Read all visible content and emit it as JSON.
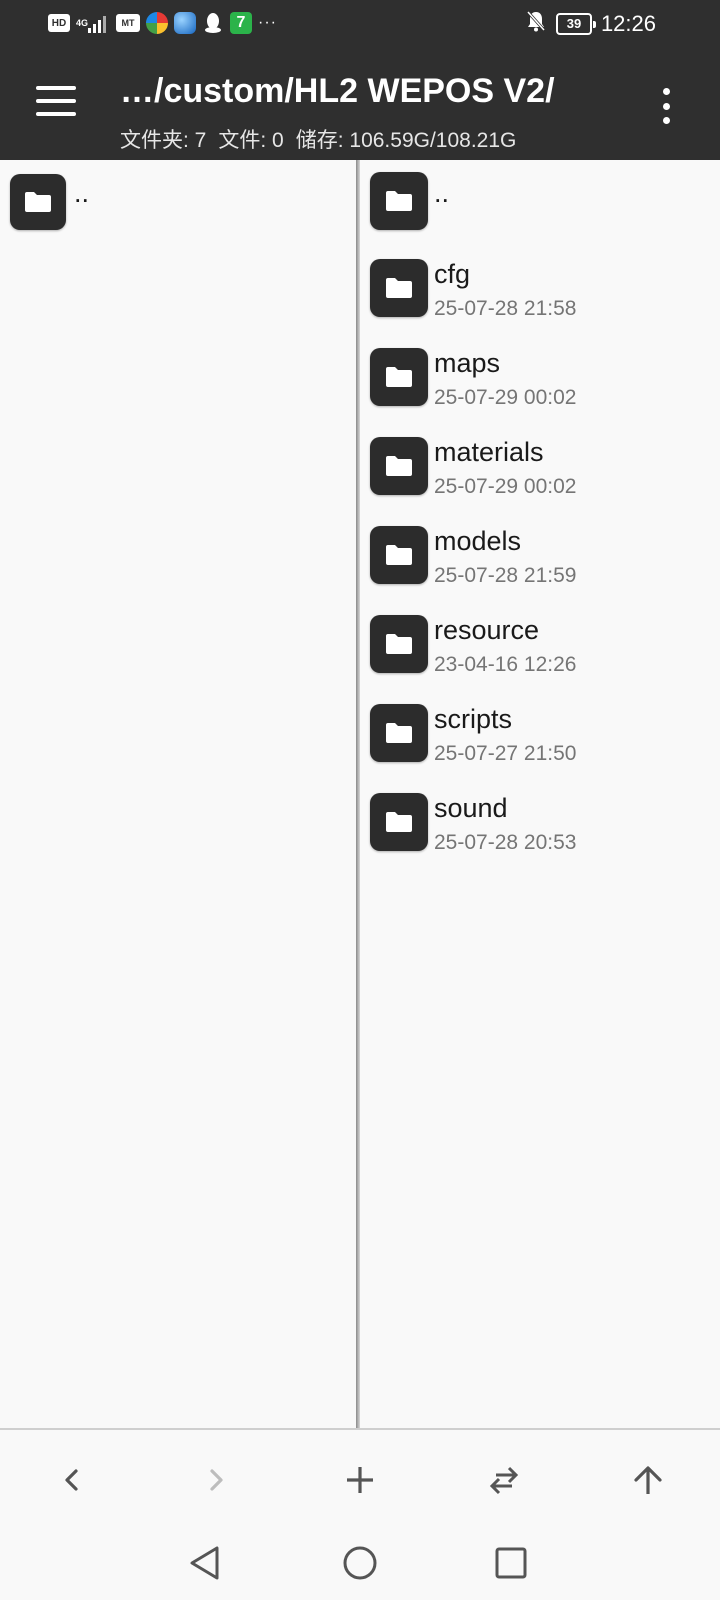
{
  "status_bar": {
    "hd_label": "HD",
    "network_label": "4G",
    "mt_label": "MT",
    "seven_label": "7",
    "more": "···",
    "battery": "39",
    "time": "12:26"
  },
  "app_bar": {
    "path": "…/custom/HL2 WEPOS V2/",
    "folders_count": "文件夹: 7",
    "files_count": "文件: 0",
    "storage": "储存: 106.59G/108.21G"
  },
  "left_pane": {
    "items": [
      {
        "name": ".."
      }
    ]
  },
  "right_pane": {
    "parent": {
      "name": ".."
    },
    "items": [
      {
        "name": "cfg",
        "date": "25-07-28 21:58"
      },
      {
        "name": "maps",
        "date": "25-07-29 00:02"
      },
      {
        "name": "materials",
        "date": "25-07-29 00:02"
      },
      {
        "name": "models",
        "date": "25-07-28 21:59"
      },
      {
        "name": "resource",
        "date": "23-04-16 12:26"
      },
      {
        "name": "scripts",
        "date": "25-07-27 21:50"
      },
      {
        "name": "sound",
        "date": "25-07-28 20:53"
      }
    ]
  },
  "toolbar": {
    "buttons": [
      "back-icon",
      "forward-icon",
      "add-icon",
      "swap-icon",
      "up-icon"
    ]
  },
  "colors": {
    "bar_background": "#2f2f2f",
    "folder_icon": "#2c2c2c",
    "date_text": "#757575"
  }
}
